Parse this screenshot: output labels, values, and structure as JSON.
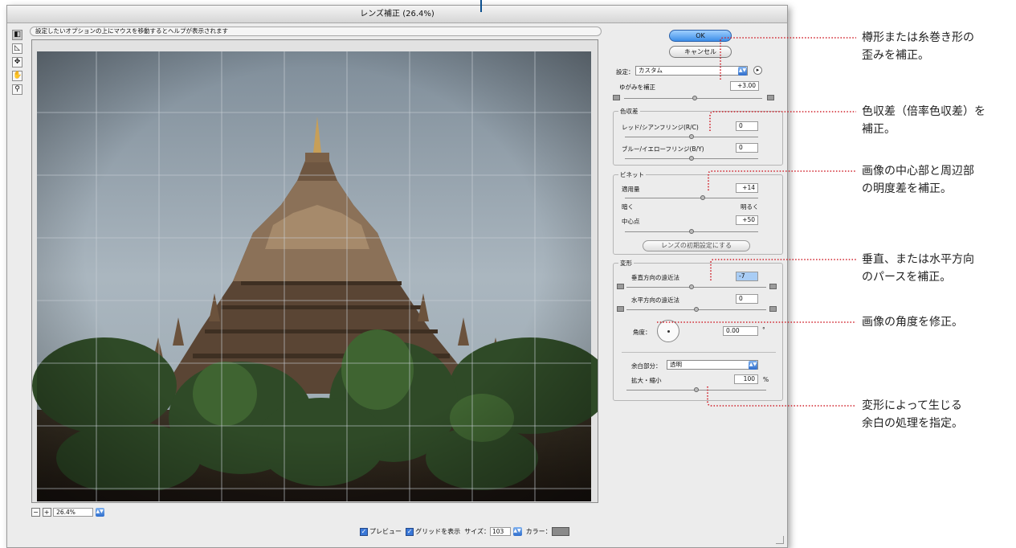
{
  "dialog": {
    "title": "レンズ補正 (26.4%)",
    "help_text": "設定したいオプションの上にマウスを移動するとヘルプが表示されます"
  },
  "tools": [
    {
      "name": "remove-distortion-tool",
      "glyph": "◧"
    },
    {
      "name": "straighten-tool",
      "glyph": "◺"
    },
    {
      "name": "move-grid-tool",
      "glyph": "✥"
    },
    {
      "name": "hand-tool",
      "glyph": "✋"
    },
    {
      "name": "zoom-tool",
      "glyph": "⚲"
    }
  ],
  "zoom": {
    "minus": "−",
    "plus": "+",
    "value": "26.4%"
  },
  "bottom_bar": {
    "preview_label": "プレビュー",
    "show_grid_label": "グリッドを表示",
    "size_label": "サイズ：",
    "size_value": "103",
    "color_label": "カラー：",
    "grid_color": "#8a8a8a"
  },
  "buttons": {
    "ok": "OK",
    "cancel": "キャンセル"
  },
  "settings": {
    "label": "設定：",
    "value": "カスタム"
  },
  "distortion": {
    "label": "ゆがみを補正",
    "value": "+3.00",
    "amount": 3.0
  },
  "chromatic": {
    "legend": "色収差",
    "red_cyan_label": "レッド/シアンフリンジ(R/C)",
    "red_cyan_value": "0",
    "blue_yellow_label": "ブルー/イエローフリンジ(B/Y)",
    "blue_yellow_value": "0"
  },
  "vignette": {
    "legend": "ビネット",
    "amount_label": "適用量",
    "amount_value": "+14",
    "darken_label": "暗く",
    "lighten_label": "明るく",
    "midpoint_label": "中心点",
    "midpoint_value": "+50"
  },
  "lens_default_button": "レンズの初期設定にする",
  "transform": {
    "legend": "変形",
    "vertical_label": "垂直方向の遠近法",
    "vertical_value": "-7",
    "horizontal_label": "水平方向の遠近法",
    "horizontal_value": "0",
    "angle_label": "角度：",
    "angle_value": "0.00",
    "angle_unit": "°",
    "edge_label": "余白部分：",
    "edge_value": "透明",
    "scale_label": "拡大・縮小",
    "scale_value": "100",
    "scale_unit": "%"
  },
  "annotations": [
    {
      "line1": "樽形または糸巻き形の",
      "line2": "歪みを補正。"
    },
    {
      "line1": "色収差（倍率色収差）を",
      "line2": "補正。"
    },
    {
      "line1": "画像の中心部と周辺部",
      "line2": "の明度差を補正。"
    },
    {
      "line1": "垂直、または水平方向",
      "line2": "のパースを補正。"
    },
    {
      "line1": "画像の角度を修正。",
      "line2": ""
    },
    {
      "line1": "変形によって生じる",
      "line2": "余白の処理を指定。"
    }
  ],
  "colors": {
    "callout": "#d0202a",
    "accent": "#3c8ee8"
  }
}
